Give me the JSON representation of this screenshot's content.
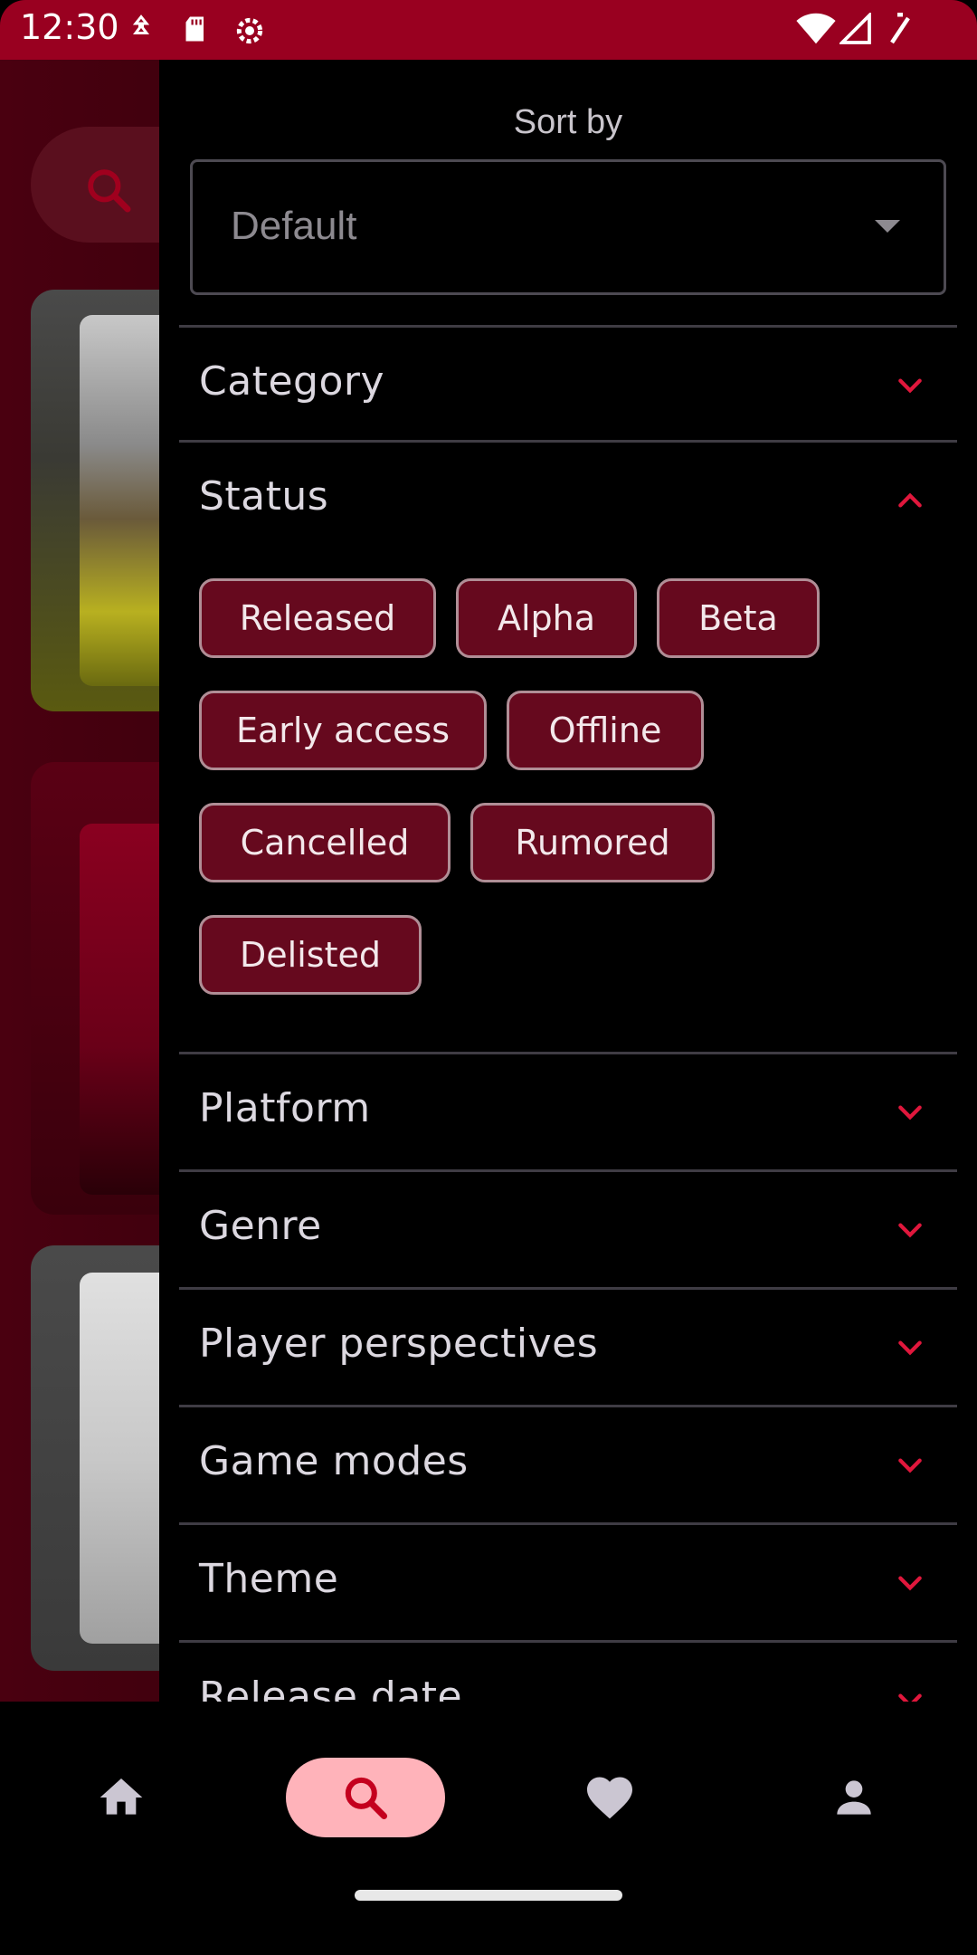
{
  "status_bar": {
    "time": "12:30",
    "icons_left": [
      "pin-icon",
      "sd-card-icon",
      "settings-icon"
    ],
    "icons_right": [
      "wifi-icon",
      "signal-icon",
      "battery-icon"
    ],
    "color": "#990020"
  },
  "drawer": {
    "sort": {
      "title": "Sort by",
      "selected_value": "Default"
    },
    "sections": [
      {
        "label": "Category",
        "expanded": false
      },
      {
        "label": "Status",
        "expanded": true,
        "chips": [
          "Released",
          "Alpha",
          "Beta",
          "Early access",
          "Offline",
          "Cancelled",
          "Rumored",
          "Delisted"
        ]
      },
      {
        "label": "Platform",
        "expanded": false
      },
      {
        "label": "Genre",
        "expanded": false
      },
      {
        "label": "Player perspectives",
        "expanded": false
      },
      {
        "label": "Game modes",
        "expanded": false
      },
      {
        "label": "Theme",
        "expanded": false
      },
      {
        "label": "Release date",
        "expanded": false
      }
    ]
  },
  "bottom_nav": {
    "items": [
      {
        "icon": "home-icon",
        "active": false
      },
      {
        "icon": "search-icon",
        "active": true
      },
      {
        "icon": "heart-icon",
        "active": false
      },
      {
        "icon": "profile-icon",
        "active": false
      }
    ]
  },
  "colors": {
    "accent": "#e0173c",
    "chip_bg": "#66091e",
    "chip_border": "#b08e96",
    "active_nav": "#ffb3ba"
  }
}
